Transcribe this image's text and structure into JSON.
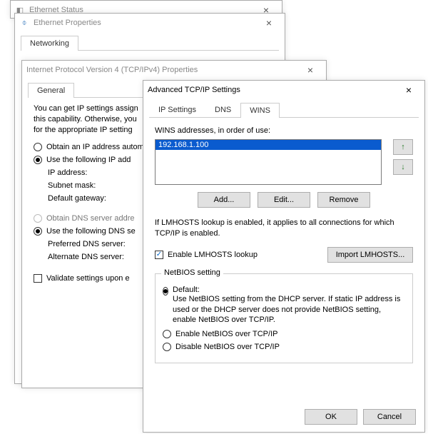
{
  "win_status": {
    "title": "Ethernet Status"
  },
  "win_props": {
    "title": "Ethernet Properties",
    "tabs": {
      "networking": "Networking"
    }
  },
  "win_ipv4": {
    "title": "Internet Protocol Version 4 (TCP/IPv4) Properties",
    "tabs": {
      "general": "General"
    },
    "intro": "You can get IP settings assigned automatically if your network supports this capability. Otherwise, you need to ask your network administrator for the appropriate IP settings.",
    "obtain_ip": "Obtain an IP address automatically",
    "use_ip": "Use the following IP address:",
    "ip_label": "IP address:",
    "mask_label": "Subnet mask:",
    "gw_label": "Default gateway:",
    "obtain_dns": "Obtain DNS server address automatically",
    "use_dns": "Use the following DNS server addresses:",
    "pref_dns": "Preferred DNS server:",
    "alt_dns": "Alternate DNS server:",
    "validate": "Validate settings upon exit"
  },
  "win_adv": {
    "title": "Advanced TCP/IP Settings",
    "tabs": {
      "ip": "IP Settings",
      "dns": "DNS",
      "wins": "WINS"
    },
    "wins_label": "WINS addresses, in order of use:",
    "wins_entry": "192.168.1.100",
    "btn_add": "Add...",
    "btn_edit": "Edit...",
    "btn_remove": "Remove",
    "lmhosts_text": "If LMHOSTS lookup is enabled, it applies to all connections for which TCP/IP is enabled.",
    "enable_lmhosts": "Enable LMHOSTS lookup",
    "btn_import_lmhosts": "Import LMHOSTS...",
    "netbios_legend": "NetBIOS setting",
    "nb_default_label": "Default:",
    "nb_default_desc": "Use NetBIOS setting from the DHCP server. If static IP address is used or the DHCP server does not provide NetBIOS setting, enable NetBIOS over TCP/IP.",
    "nb_enable": "Enable NetBIOS over TCP/IP",
    "nb_disable": "Disable NetBIOS over TCP/IP",
    "btn_ok": "OK",
    "btn_cancel": "Cancel"
  }
}
